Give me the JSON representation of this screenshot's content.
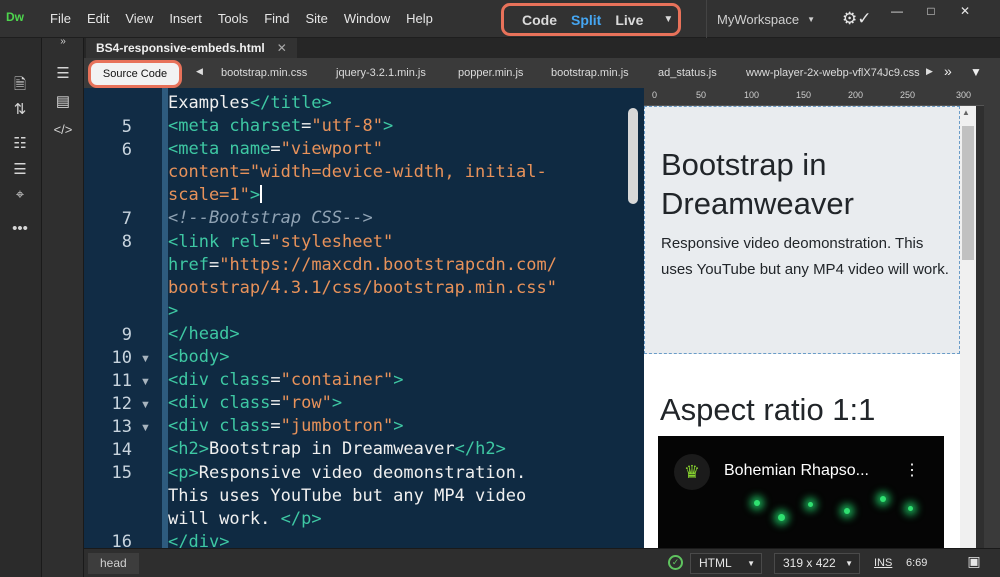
{
  "app": {
    "logo": "Dw"
  },
  "menu": [
    "File",
    "Edit",
    "View",
    "Insert",
    "Tools",
    "Find",
    "Site",
    "Window",
    "Help"
  ],
  "view_modes": {
    "code": "Code",
    "split": "Split",
    "live": "Live",
    "active": "Split"
  },
  "workspace": "MyWorkspace",
  "document": {
    "tab": "BS4-responsive-embeds.html"
  },
  "related_files": {
    "source_code": "Source Code",
    "files": [
      "bootstrap.min.css",
      "jquery-3.2.1.min.js",
      "popper.min.js",
      "bootstrap.min.js",
      "ad_status.js",
      "www-player-2x-webp-vflX74Jc9.css"
    ]
  },
  "code": {
    "line_numbers": [
      "5",
      "6",
      "7",
      "8",
      "9",
      "10",
      "11",
      "12",
      "13",
      "14",
      "15",
      "16"
    ],
    "fragment_top": "Examples</title>",
    "lines": [
      "Examples</title>",
      "<meta charset=\"utf-8\">",
      "<meta name=\"viewport\"",
      "content=\"width=device-width, initial-",
      "scale=1\">",
      "<!--Bootstrap CSS-->",
      "<link rel=\"stylesheet\"",
      "href=\"https://maxcdn.bootstrapcdn.com/",
      "bootstrap/4.3.1/css/bootstrap.min.css\"",
      ">",
      "</head>",
      "<body>",
      "<div class=\"container\">",
      "<div class=\"row\">",
      "<div class=\"jumbotron\">",
      "<h2>Bootstrap in Dreamweaver</h2>",
      "<p>Responsive video deomonstration.",
      "This uses YouTube but any MP4 video",
      "will work. </p>",
      "</div>"
    ]
  },
  "ruler": [
    "0",
    "50",
    "100",
    "150",
    "200",
    "250",
    "300"
  ],
  "preview": {
    "jumbotron_title": "Bootstrap in Dreamweaver",
    "jumbotron_text": "Responsive video deomonstration. This uses YouTube but any MP4 video will work.",
    "section_title": "Aspect ratio 1:1",
    "video_title": "Bohemian Rhapso..."
  },
  "status": {
    "tag": "head",
    "language": "HTML",
    "size": "319 x 422",
    "mode": "INS",
    "position": "6:69"
  }
}
